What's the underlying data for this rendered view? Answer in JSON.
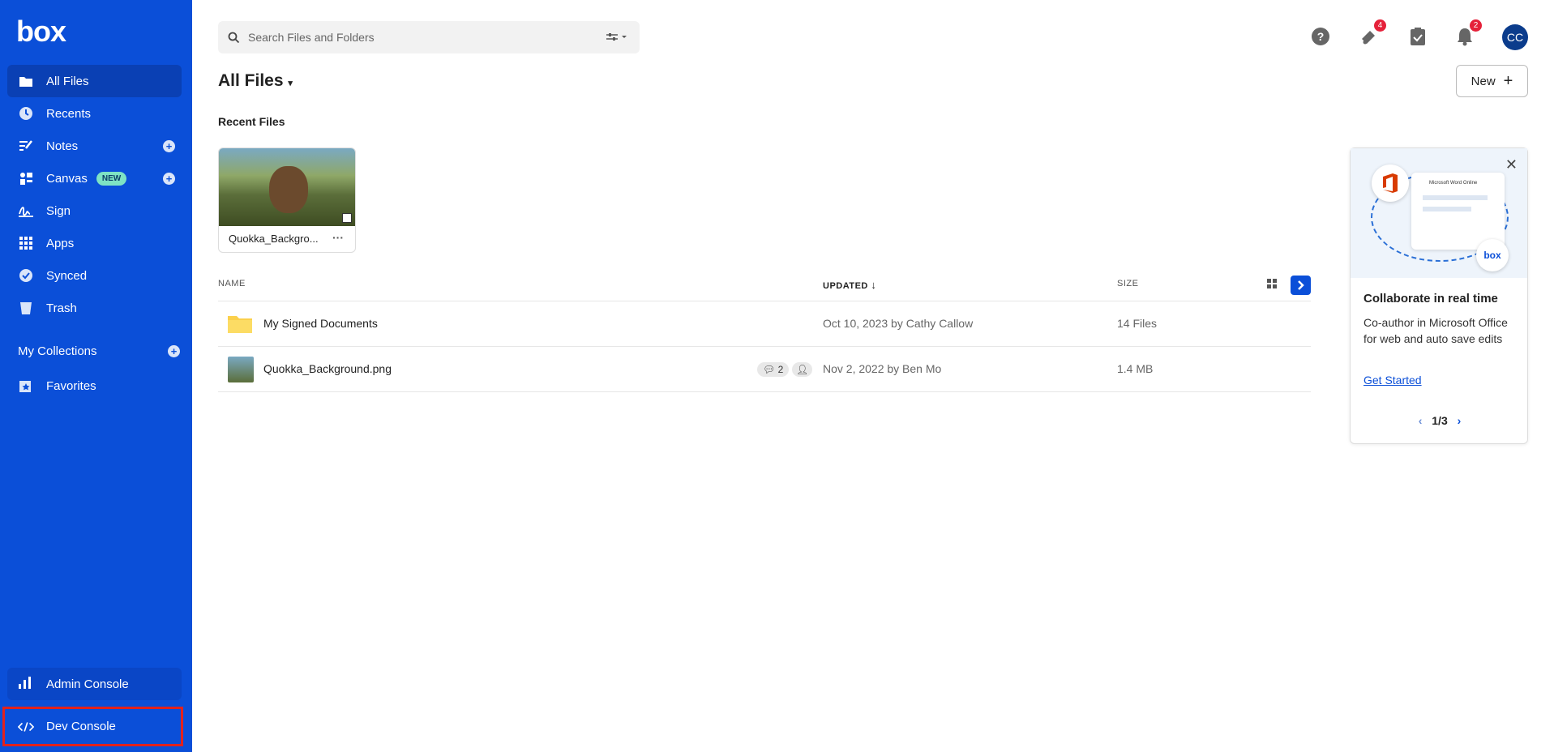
{
  "brand": {
    "logo": "box"
  },
  "sidebar": {
    "items": [
      {
        "label": "All Files",
        "icon": "folder-icon"
      },
      {
        "label": "Recents",
        "icon": "clock-icon"
      },
      {
        "label": "Notes",
        "icon": "notes-icon"
      },
      {
        "label": "Canvas",
        "icon": "canvas-icon",
        "badge": "NEW"
      },
      {
        "label": "Sign",
        "icon": "sign-icon"
      },
      {
        "label": "Apps",
        "icon": "apps-grid-icon"
      },
      {
        "label": "Synced",
        "icon": "check-circle-icon"
      },
      {
        "label": "Trash",
        "icon": "trash-icon"
      }
    ],
    "collections_label": "My Collections",
    "favorites_label": "Favorites",
    "admin_label": "Admin Console",
    "dev_label": "Dev Console"
  },
  "search": {
    "placeholder": "Search Files and Folders"
  },
  "header": {
    "notif_count_a": "4",
    "notif_count_b": "2",
    "avatar": "CC"
  },
  "main": {
    "title": "All Files",
    "new_button": "New",
    "recent_label": "Recent Files",
    "recent_card_name": "Quokka_Backgro...",
    "columns": {
      "name": "NAME",
      "updated": "UPDATED",
      "size": "SIZE"
    },
    "rows": [
      {
        "name": "My Signed Documents",
        "updated": "Oct 10, 2023 by Cathy Callow",
        "size": "14 Files"
      },
      {
        "name": "Quokka_Background.png",
        "updated": "Nov 2, 2022 by Ben Mo",
        "size": "1.4 MB",
        "comments": "2"
      }
    ]
  },
  "promo": {
    "title": "Collaborate in real time",
    "body": "Co-author in Microsoft Office for web and auto save edits",
    "link": "Get Started",
    "pager": "1/3",
    "art_header": "Microsoft Word Online",
    "art_logo": "box"
  },
  "colors": {
    "sidebar": "#0b4fd8",
    "accent": "#0b4fd8",
    "badge_red": "#e5213a",
    "highlight": "#e1221d"
  }
}
